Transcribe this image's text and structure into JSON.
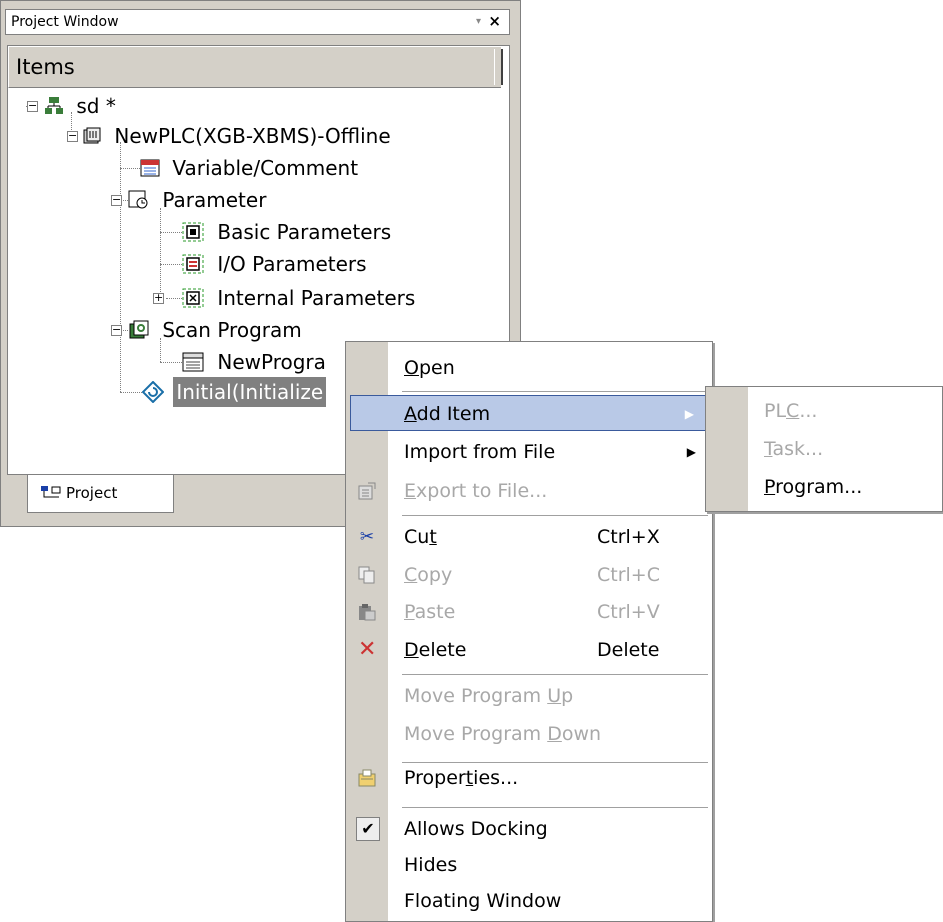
{
  "project_window": {
    "title": "Project Window",
    "pin": "▾",
    "close": "×",
    "header": "Items",
    "tree": [
      {
        "label": "sd *",
        "icon": "network-icon"
      },
      {
        "label": "NewPLC(XGB-XBMS)-Offline",
        "icon": "plc-icon"
      },
      {
        "label": "Variable/Comment",
        "icon": "variable-icon"
      },
      {
        "label": "Parameter",
        "icon": "parameter-icon"
      },
      {
        "label": "Basic Parameters",
        "icon": "basic-param-icon"
      },
      {
        "label": "I/O Parameters",
        "icon": "io-param-icon"
      },
      {
        "label": "Internal Parameters",
        "icon": "internal-param-icon"
      },
      {
        "label": "Scan Program",
        "icon": "scan-program-icon"
      },
      {
        "label": "NewProgra",
        "icon": "program-icon"
      },
      {
        "label": "Initial(Initialize",
        "icon": "initial-icon"
      }
    ],
    "tab_label": "Project"
  },
  "context_menu": {
    "items": [
      {
        "label_pre": "",
        "label_u": "O",
        "label_post": "pen",
        "shortcut": ""
      },
      {
        "label_pre": "",
        "label_u": "A",
        "label_post": "dd Item",
        "shortcut": "",
        "submenu": true
      },
      {
        "label_pre": "Import from File",
        "label_u": "",
        "label_post": "",
        "shortcut": "",
        "submenu": true
      },
      {
        "label_pre": "",
        "label_u": "E",
        "label_post": "xport to File...",
        "shortcut": ""
      },
      {
        "label_pre": "Cu",
        "label_u": "t",
        "label_post": "",
        "shortcut": "Ctrl+X"
      },
      {
        "label_pre": "",
        "label_u": "C",
        "label_post": "opy",
        "shortcut": "Ctrl+C"
      },
      {
        "label_pre": "",
        "label_u": "P",
        "label_post": "aste",
        "shortcut": "Ctrl+V"
      },
      {
        "label_pre": "",
        "label_u": "D",
        "label_post": "elete",
        "shortcut": "Delete"
      },
      {
        "label_pre": "Move Program ",
        "label_u": "U",
        "label_post": "p",
        "shortcut": ""
      },
      {
        "label_pre": "Move Program ",
        "label_u": "D",
        "label_post": "own",
        "shortcut": ""
      },
      {
        "label_pre": "Proper",
        "label_u": "t",
        "label_post": "ies...",
        "shortcut": ""
      },
      {
        "label_pre": "Allows Docking",
        "label_u": "",
        "label_post": "",
        "shortcut": ""
      },
      {
        "label_pre": "Hides",
        "label_u": "",
        "label_post": "",
        "shortcut": ""
      },
      {
        "label_pre": "Floating Window",
        "label_u": "",
        "label_post": "",
        "shortcut": ""
      }
    ],
    "submenu_arrow": "▶",
    "checkmark": "✔"
  },
  "add_item_submenu": {
    "items": [
      {
        "label_pre": "PL",
        "label_u": "C",
        "label_post": "..."
      },
      {
        "label_pre": "",
        "label_u": "T",
        "label_post": "ask..."
      },
      {
        "label_pre": "",
        "label_u": "P",
        "label_post": "rogram..."
      }
    ]
  }
}
